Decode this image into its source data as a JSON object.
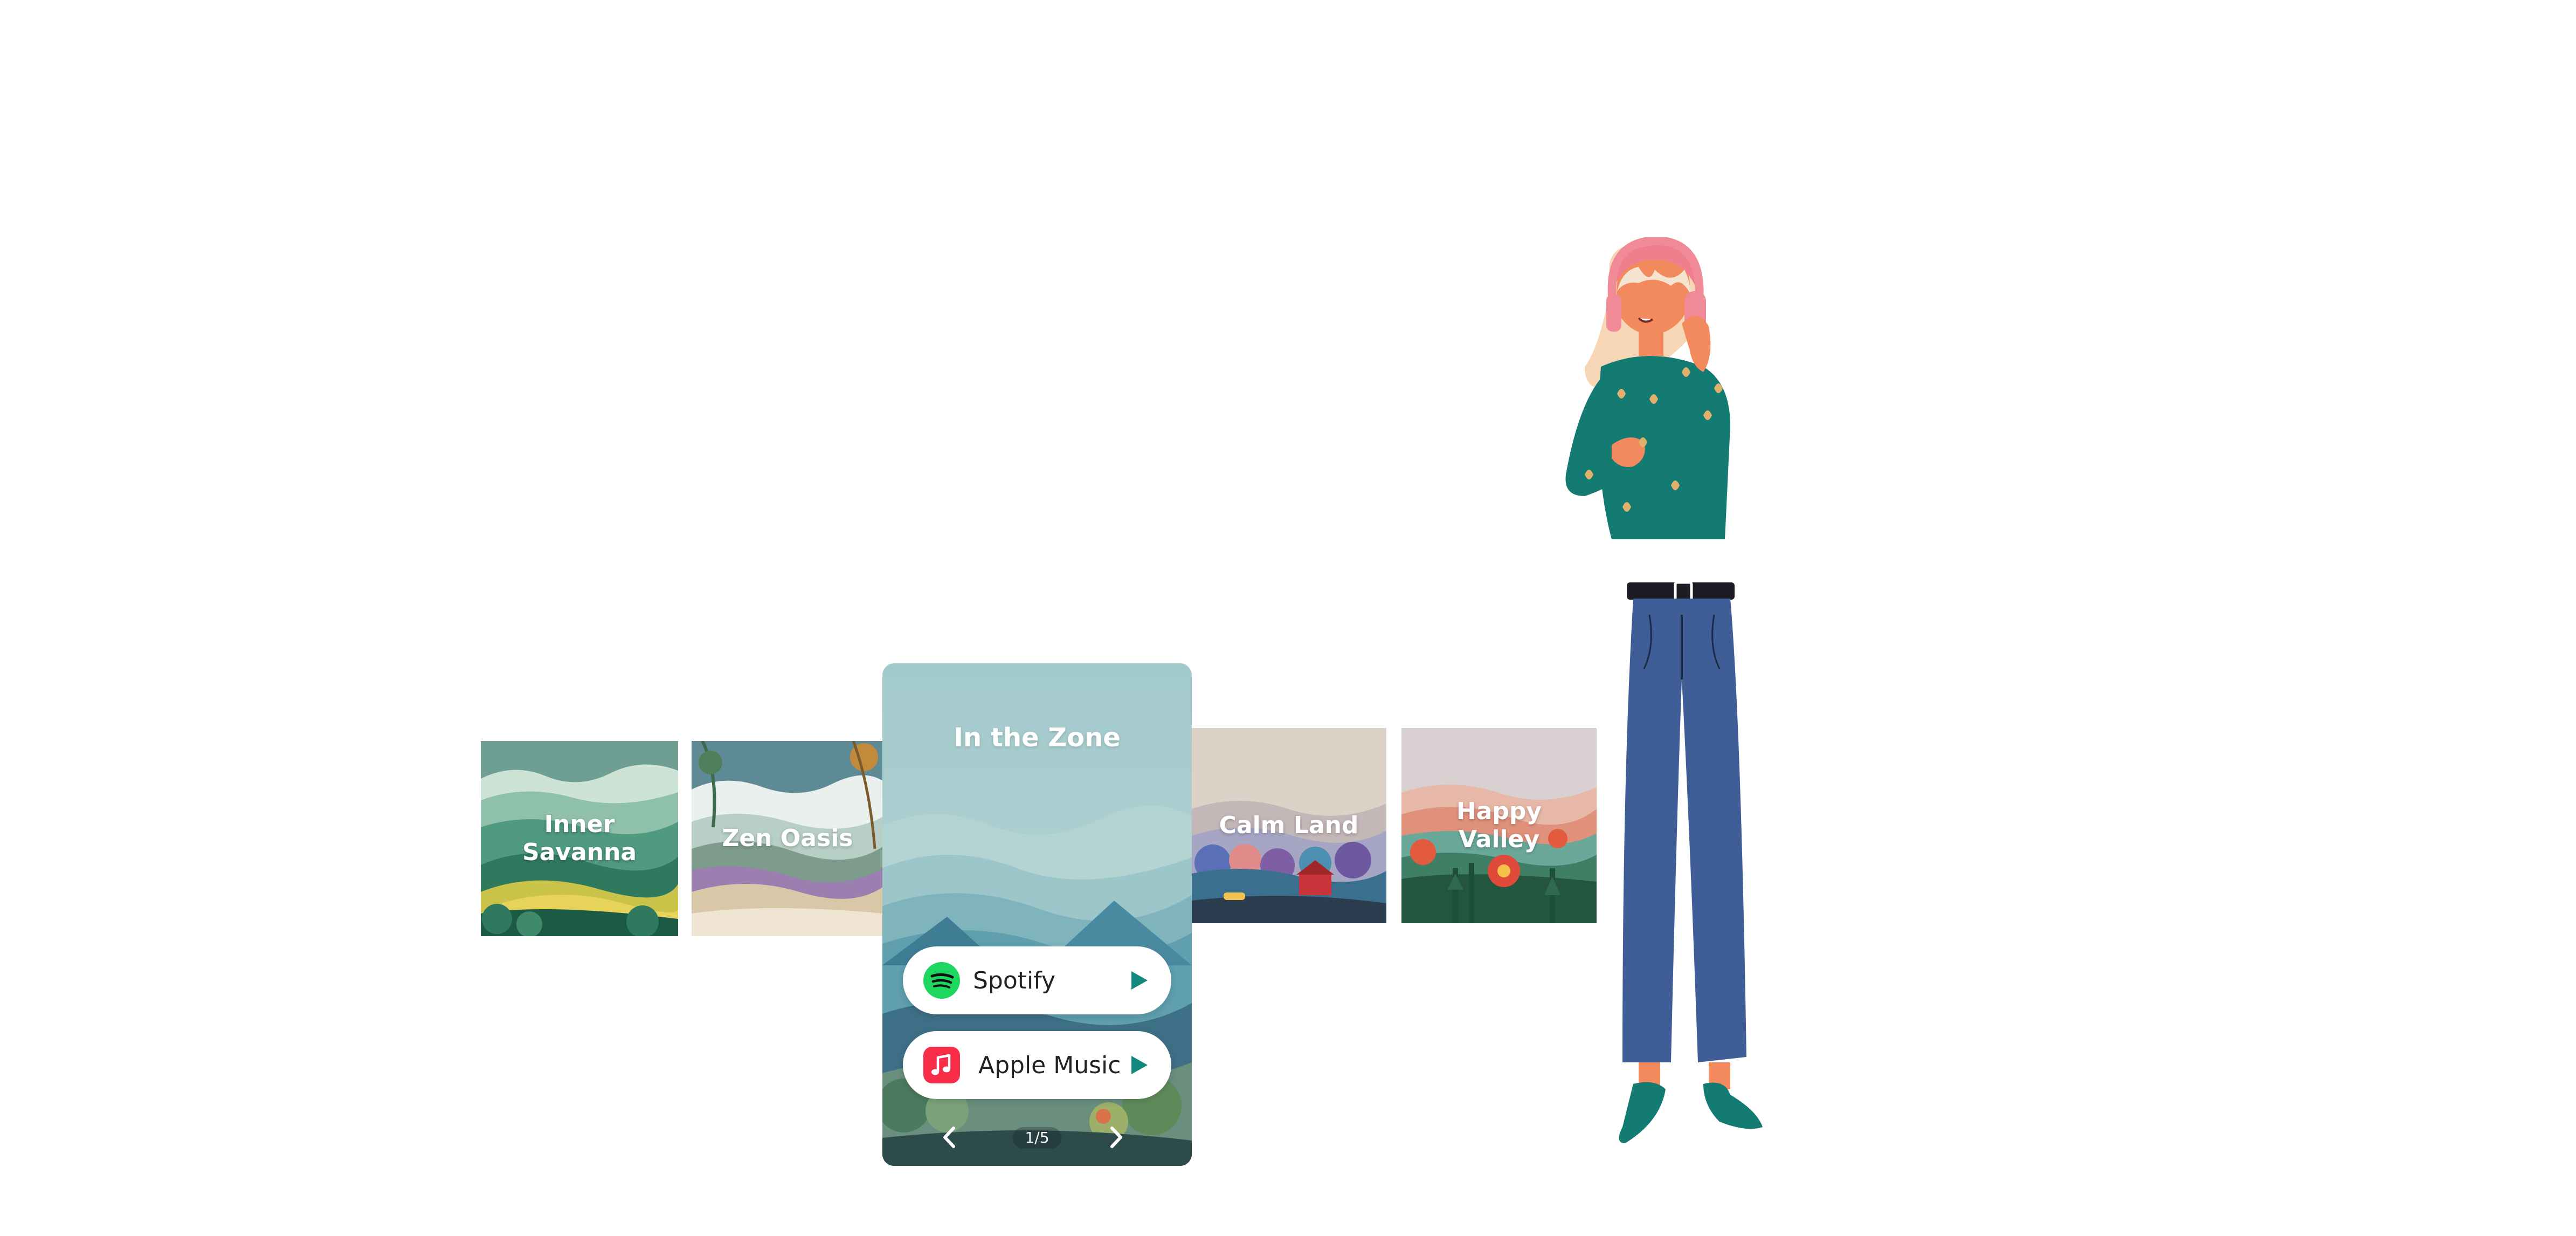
{
  "playlists": {
    "inner_savanna": "Inner Savanna",
    "zen_oasis": "Zen Oasis",
    "calm_land": "Calm Land",
    "happy_valley": "Happy Valley"
  },
  "featured": {
    "title": "In the Zone",
    "services": {
      "spotify": {
        "label": "Spotify",
        "icon": "spotify-icon"
      },
      "apple_music": {
        "label": "Apple Music",
        "icon": "apple-music-icon"
      }
    },
    "pager": {
      "current": "1/5",
      "prev_icon": "chevron-left-icon",
      "next_icon": "chevron-right-icon"
    }
  },
  "colors": {
    "accent_teal": "#12887e",
    "spotify_green": "#1ed760",
    "apple_music_red": "#fa2d48",
    "featured_bg": "#a9ced1"
  }
}
